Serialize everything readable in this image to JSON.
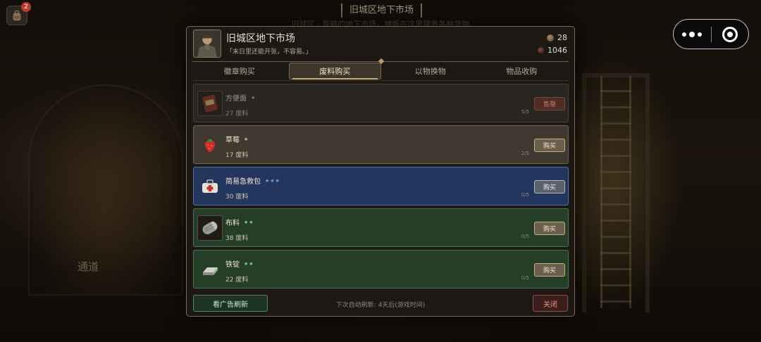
{
  "scene": {
    "title": "旧城区地下市场",
    "side_label": "通道",
    "background_hint": "旧城区 · 昏暗的地下市场，摊贩在这里摆着各种货物"
  },
  "bag": {
    "icon": "backpack-icon",
    "badge": "2"
  },
  "capsule": {
    "more_icon": "more-dots-icon",
    "close_icon": "target-close-icon"
  },
  "dialog": {
    "title": "旧城区地下市场",
    "quote": "「末日里还能开张，不容易。」",
    "currency": [
      {
        "icon": "badge-coin-icon",
        "value": "28"
      },
      {
        "icon": "scrap-coin-icon",
        "value": "1046"
      }
    ],
    "tabs": [
      {
        "label": "徽章购买",
        "active": false
      },
      {
        "label": "废料购买",
        "active": true
      },
      {
        "label": "以物换物",
        "active": false
      },
      {
        "label": "物品收购",
        "active": false
      }
    ],
    "items": [
      {
        "name": "方便面",
        "stars": "★",
        "price": "27 废料",
        "stock": "5/5",
        "button": "售罄",
        "icon": "instant-noodles-icon",
        "tier": "sold"
      },
      {
        "name": "草莓",
        "stars": "★",
        "price": "17 废料",
        "stock": "2/5",
        "button": "购买",
        "icon": "strawberry-icon",
        "tier": "gray"
      },
      {
        "name": "简易急救包",
        "stars": "★★★",
        "price": "30 废料",
        "stock": "0/5",
        "button": "购买",
        "icon": "first-aid-kit-icon",
        "tier": "blue"
      },
      {
        "name": "布料",
        "stars": "★★",
        "price": "38 废料",
        "stock": "0/5",
        "button": "购买",
        "icon": "cloth-roll-icon",
        "tier": "green"
      },
      {
        "name": "铁锭",
        "stars": "★★",
        "price": "22 废料",
        "stock": "0/5",
        "button": "购买",
        "icon": "iron-ingot-icon",
        "tier": "green"
      }
    ],
    "footer": {
      "ad_button": "看广告刷新",
      "refresh_text": "下次自动刷新: 4天后(游戏时间)",
      "close_button": "关闭"
    }
  },
  "colors": {
    "panel_bg": "#1c1915",
    "panel_border": "#7d6c50",
    "tier_gray": "#403930",
    "tier_blue": "#23375e",
    "tier_green": "#243e27",
    "buy_border": "#c8b07c",
    "close_border": "#9a4a3c",
    "ad_border": "#4f8a50"
  }
}
